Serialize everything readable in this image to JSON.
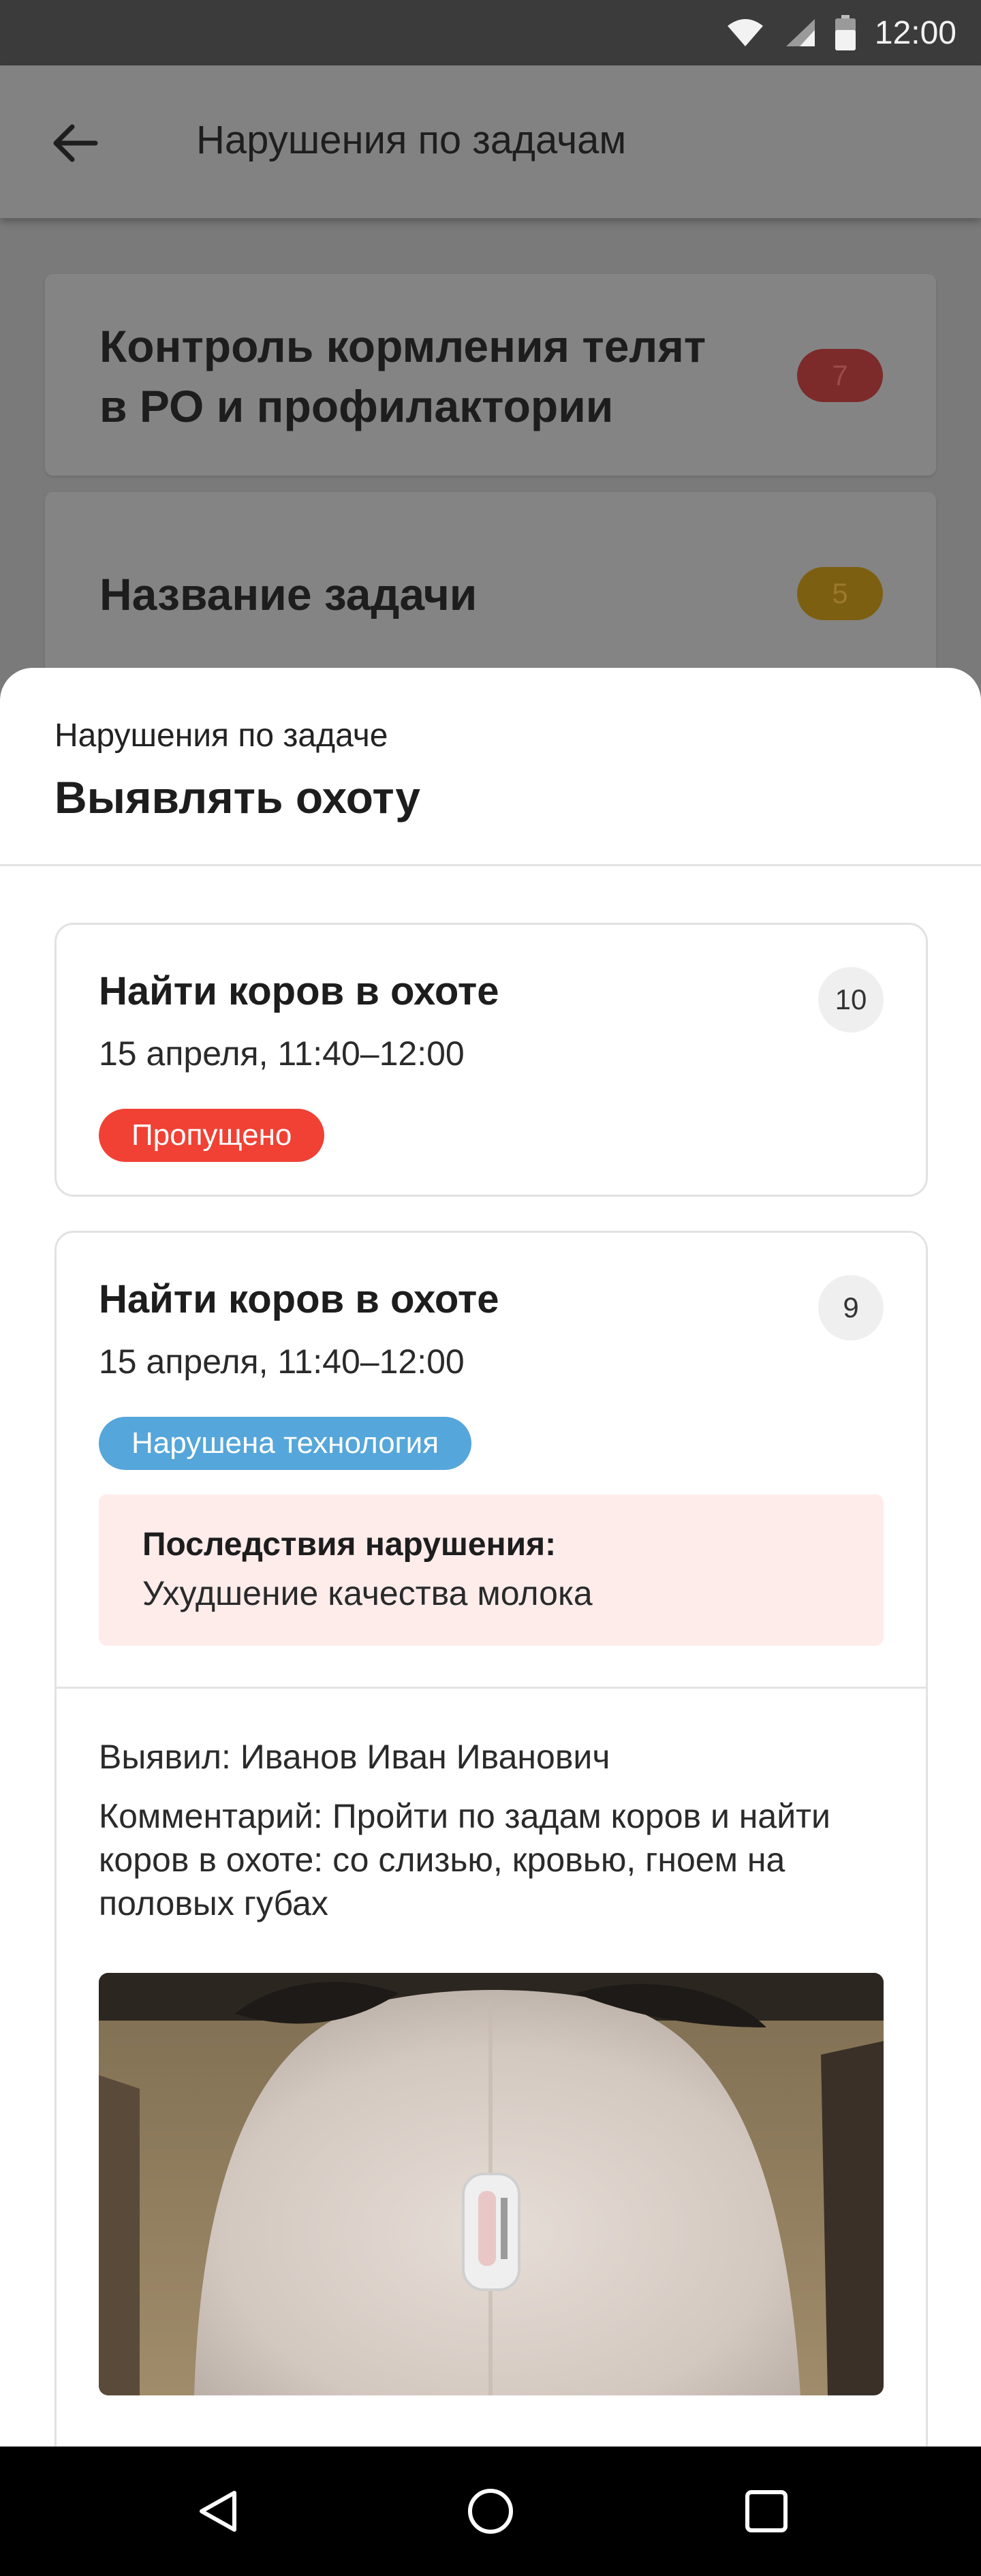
{
  "status_bar": {
    "time": "12:00"
  },
  "app_bar": {
    "title": "Нарушения по задачам"
  },
  "background_tasks": [
    {
      "label_line1": "Контроль кормления телят",
      "label_line2": "в РО и профилактории",
      "count": "7",
      "count_color": "#7d2a2a"
    },
    {
      "label_line1": "Название задачи",
      "count": "5",
      "count_color": "#7c5f10"
    }
  ],
  "sheet": {
    "subtitle": "Нарушения по задаче",
    "title": "Выявлять охоту"
  },
  "violations": [
    {
      "title": "Найти коров в охоте",
      "date": "15 апреля, 11:40–12:00",
      "number": "10",
      "status": "Пропущено",
      "status_color": "#f04134"
    },
    {
      "title": "Найти коров в охоте",
      "date": "15 апреля, 11:40–12:00",
      "number": "9",
      "status": "Нарушена технология",
      "status_color": "#55a6da",
      "consequence_label": "Последствия нарушения:",
      "consequence_text": "Ухудшение качества молока",
      "detected_by": "Выявил: Иванов Иван Иванович",
      "comment": "Комментарий: Пройти по задам коров и найти коров в охоте: со слизью, кровью, гноем на половых губах"
    }
  ],
  "icons": {
    "back": "arrow-left-icon",
    "wifi": "wifi-icon",
    "signal": "signal-icon",
    "battery": "battery-icon",
    "nav_back": "triangle-back-icon",
    "nav_home": "circle-home-icon",
    "nav_recents": "square-recents-icon"
  }
}
